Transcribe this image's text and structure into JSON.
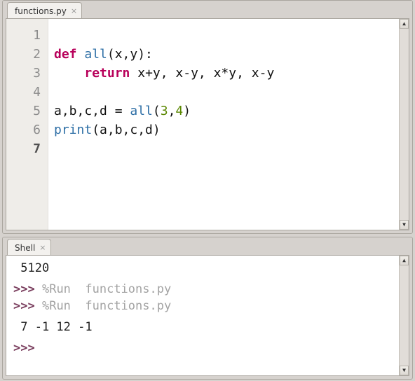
{
  "editor": {
    "tab_label": "functions.py",
    "lines": [
      {
        "n": "1",
        "html": ""
      },
      {
        "n": "2",
        "html": "<span class='kw'>def</span> <span class='fn'>all</span>(x,y):"
      },
      {
        "n": "3",
        "html": "    <span class='kw'>return</span> x+y, x-y, x*y, x-y"
      },
      {
        "n": "4",
        "html": ""
      },
      {
        "n": "5",
        "html": "a,b,c,d = <span class='fn'>all</span>(<span class='num'>3</span>,<span class='num'>4</span>)"
      },
      {
        "n": "6",
        "html": "<span class='fn'>print</span>(a,b,c,d)"
      },
      {
        "n": "7",
        "html": ""
      }
    ],
    "current_line": "7"
  },
  "shell": {
    "tab_label": "Shell",
    "output_prev": " 5120",
    "prompt": ">>>",
    "run_cmd": "%Run  functions.py",
    "output": " 7 -1 12 -1"
  }
}
